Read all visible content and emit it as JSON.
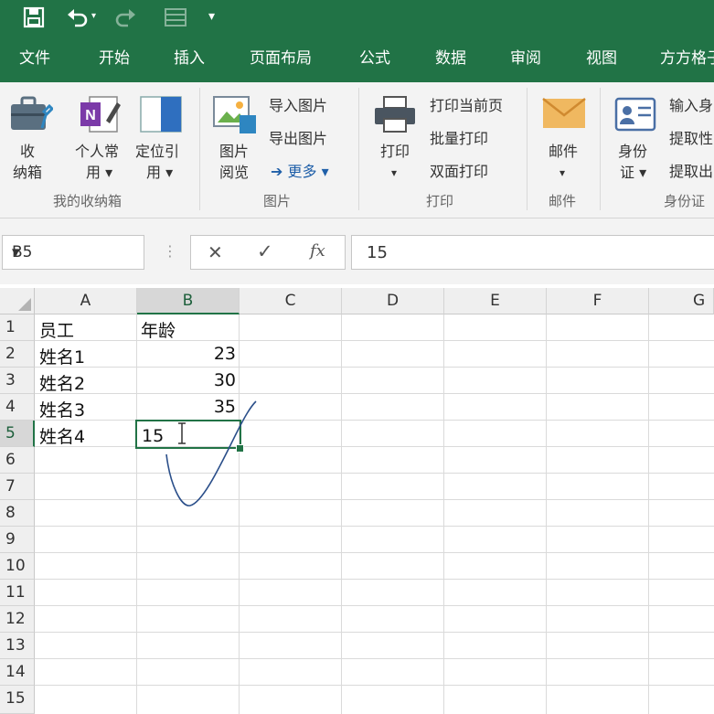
{
  "quick_access": {
    "undo_arrow": "▾",
    "customize": "▾"
  },
  "tabs": [
    "文件",
    "开始",
    "插入",
    "页面布局",
    "公式",
    "数据",
    "审阅",
    "视图",
    "方方格子"
  ],
  "ribbon": {
    "groups": {
      "storage": {
        "title": "我的收纳箱",
        "btn_storage_1": "收",
        "btn_storage_2": "纳箱",
        "btn_personal_1": "个人常",
        "btn_personal_2": "用 ▾",
        "btn_locate_1": "定位引",
        "btn_locate_2": "用 ▾"
      },
      "picture": {
        "title": "图片",
        "btn_browse_1": "图片",
        "btn_browse_2": "阅览",
        "import": "导入图片",
        "export": "导出图片",
        "more": "➔ 更多 ▾"
      },
      "print": {
        "title": "打印",
        "btn_print_1": "打印",
        "btn_print_2": "▾",
        "current_page": "打印当前页",
        "batch": "批量打印",
        "duplex": "双面打印"
      },
      "mail": {
        "title": "邮件",
        "btn_mail_1": "邮件",
        "btn_mail_2": "▾"
      },
      "idcard": {
        "title": "身份证",
        "btn_id_1": "身份",
        "btn_id_2": "证 ▾",
        "input": "输入身",
        "extract1": "提取性",
        "extract2": "提取出"
      }
    }
  },
  "formula_bar": {
    "name_box": "B5",
    "name_box_arrow": "▾",
    "dots": "⋮",
    "cancel": "✕",
    "confirm": "✓",
    "fx": "fx",
    "formula": "15"
  },
  "grid": {
    "columns": [
      "A",
      "B",
      "C",
      "D",
      "E",
      "F",
      "G"
    ],
    "rows": [
      "1",
      "2",
      "3",
      "4",
      "5",
      "6",
      "7",
      "8",
      "9",
      "10",
      "11",
      "12",
      "13",
      "14",
      "15"
    ],
    "cells": {
      "A1": "员工",
      "B1": "年龄",
      "A2": "姓名1",
      "B2": "23",
      "A3": "姓名2",
      "B3": "30",
      "A4": "姓名3",
      "B4": "35",
      "A5": "姓名4",
      "B5": "15"
    },
    "selected_cell": "B5"
  },
  "colors": {
    "accent": "#217346",
    "annotation": "#2b4f8a"
  }
}
